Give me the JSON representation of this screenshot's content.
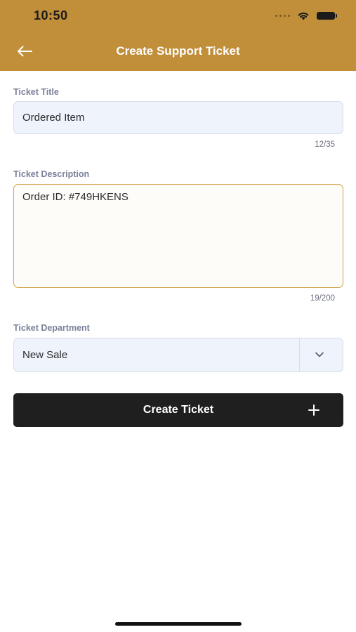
{
  "status_bar": {
    "time": "10:50"
  },
  "header": {
    "title": "Create Support Ticket",
    "back_icon": "arrow-left-icon",
    "background_color": "#C18E3A"
  },
  "form": {
    "title_field": {
      "label": "Ticket Title",
      "value": "Ordered Item",
      "counter": "12/35"
    },
    "description_field": {
      "label": "Ticket Description",
      "value": "Order ID: #749HKENS",
      "counter": "19/200"
    },
    "department_field": {
      "label": "Ticket Department",
      "selected": "New Sale",
      "icon": "chevron-down-icon"
    }
  },
  "actions": {
    "create_label": "Create Ticket",
    "create_icon": "plus-icon"
  }
}
